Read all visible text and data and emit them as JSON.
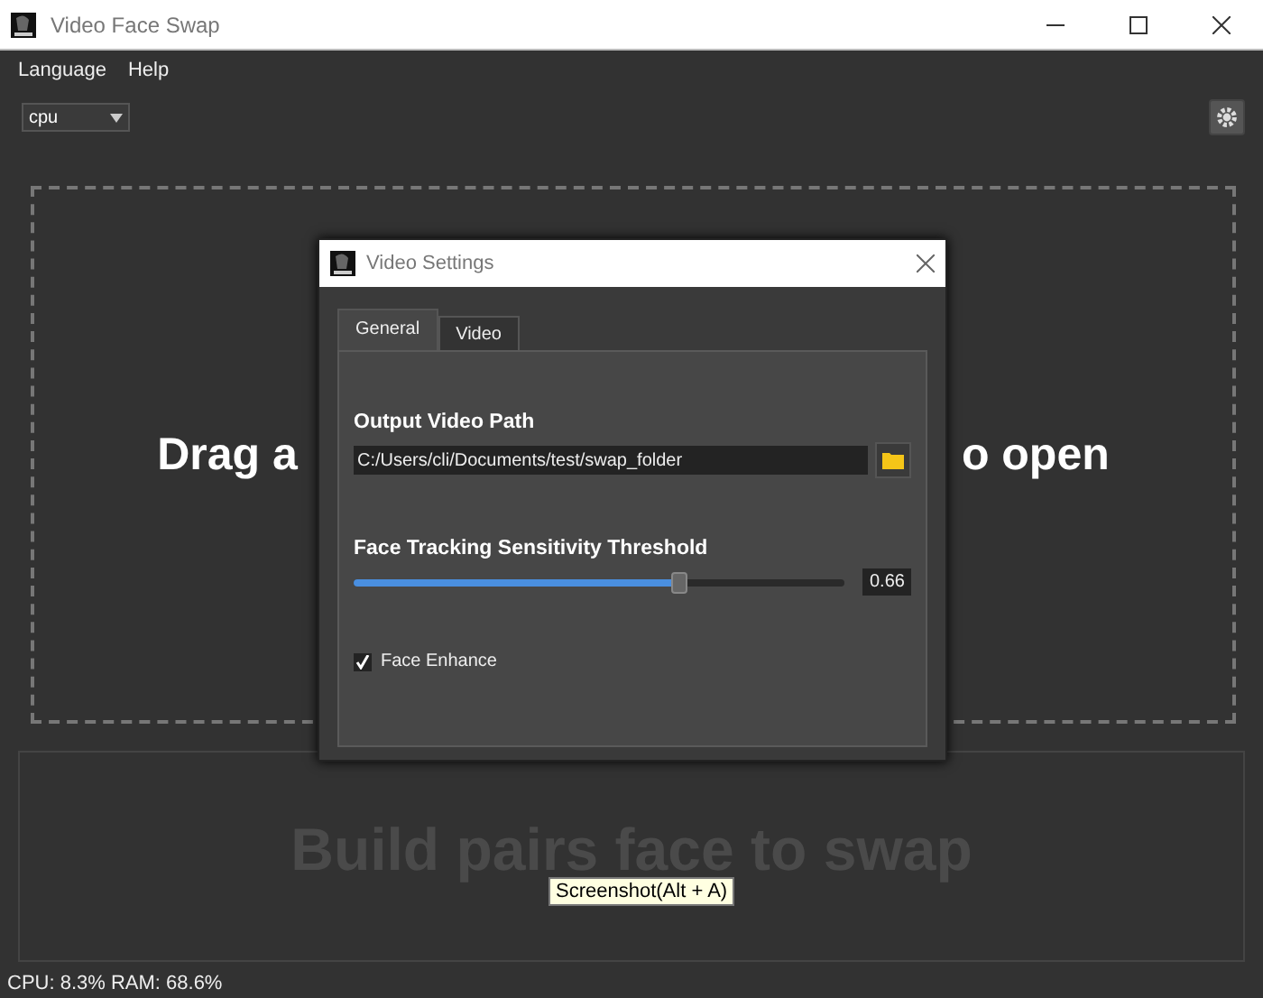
{
  "window": {
    "title": "Video Face Swap"
  },
  "menu": [
    "Language",
    "Help"
  ],
  "device": {
    "value": "cpu"
  },
  "drop_zone": {
    "text_left": "Drag a",
    "text_right": "o open"
  },
  "pairs_panel": {
    "text": "Build pairs face to swap"
  },
  "tooltip": {
    "text": "Screenshot(Alt + A)"
  },
  "status_bar": {
    "text": "CPU: 8.3%  RAM: 68.6%"
  },
  "dialog": {
    "title": "Video Settings",
    "tabs": [
      {
        "label": "General",
        "selected": true
      },
      {
        "label": "Video",
        "selected": false
      }
    ],
    "output_path": {
      "label": "Output Video Path",
      "value": "C:/Users/cli/Documents/test/swap_folder"
    },
    "threshold": {
      "label": "Face Tracking Sensitivity Threshold",
      "level": 0.66,
      "reading": "0.66"
    },
    "face_enhance": {
      "label": "Face Enhance",
      "checked": true
    }
  }
}
